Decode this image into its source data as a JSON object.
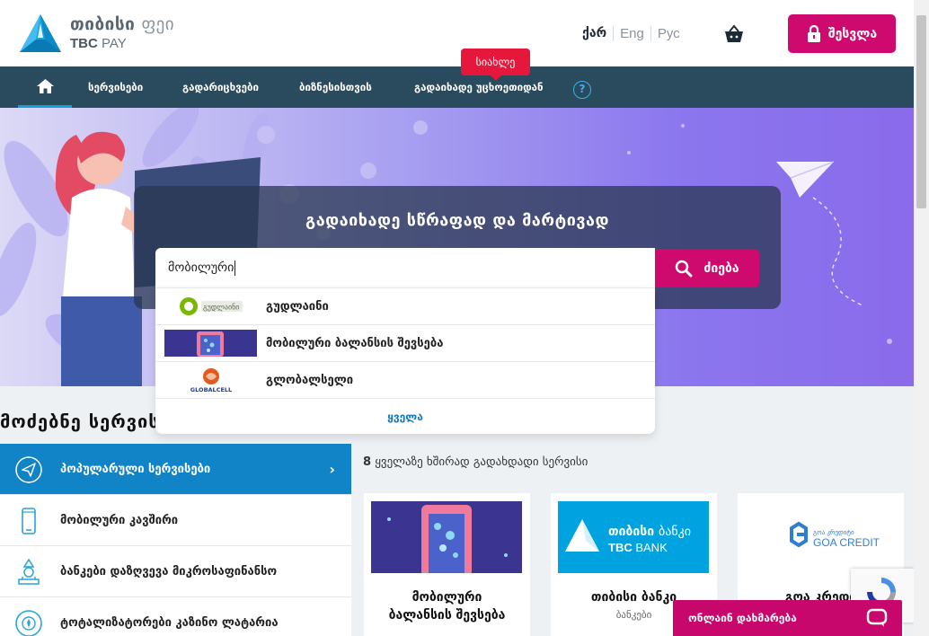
{
  "header": {
    "logo_line1_bold": "თიბისი",
    "logo_line1_light": "ფეი",
    "logo_line2_bold": "TBC",
    "logo_line2_light": "PAY",
    "languages": [
      "ქარ",
      "Eng",
      "Рус"
    ],
    "login_label": "შესვლა",
    "accent_color": "#cf0a6e"
  },
  "nav": {
    "items": [
      "სერვისები",
      "გადარიცხვები",
      "ბიზნესისთვის",
      "გადაიხადე უცხოეთიდან"
    ],
    "help": "?",
    "new_badge": "სიახლე",
    "bg_color": "#2a4a5e"
  },
  "hero": {
    "title": "გადაიხადე სწრაფად და მარტივად",
    "search_value": "მობილური",
    "search_button": "ძიება"
  },
  "dropdown": {
    "items": [
      {
        "label": "გუდლაინი",
        "logo_text": "გუდლაინი"
      },
      {
        "label": "მობილური ბალანსის შევსება",
        "logo_text": ""
      },
      {
        "label": "გლობალსელი",
        "logo_text": "GLOBALCELL"
      }
    ],
    "all_label": "ყველა"
  },
  "section": {
    "title": "მოძებნე სერვისი"
  },
  "categories": [
    {
      "label": "პოპულარული სერვისები",
      "icon": "paper-plane-icon",
      "active": true
    },
    {
      "label": "მობილური კავშირი",
      "icon": "mobile-phone-icon",
      "active": false
    },
    {
      "label": "ბანკები დაზღვევა მიკროსაფინანსო",
      "icon": "bank-icon",
      "active": false
    },
    {
      "label": "ტოტალიზატორები კაზინო ლატარია",
      "icon": "casino-chip-icon",
      "active": false
    }
  ],
  "popular": {
    "count": "8",
    "caption": "ყველაზე ხშირად გადახდადი სერვისი",
    "cards": [
      {
        "title_line1": "მობილური",
        "title_line2": "ბალანსის შევსება",
        "sub": ""
      },
      {
        "title_line1": "თიბისი ბანკი",
        "title_line2": "",
        "sub": "ბანკები",
        "logo_geo": "თიბისი",
        "logo_geo_light": "ბანკი",
        "logo_en": "TBC",
        "logo_en_light": "BANK"
      },
      {
        "title_line1": "გოა კრედი",
        "title_line2": "",
        "sub": "",
        "logo_geo": "გოა კრედიტი",
        "logo_en": "GOA CREDIT"
      }
    ]
  },
  "chat": {
    "label": "ონლაინ დახმარება"
  }
}
